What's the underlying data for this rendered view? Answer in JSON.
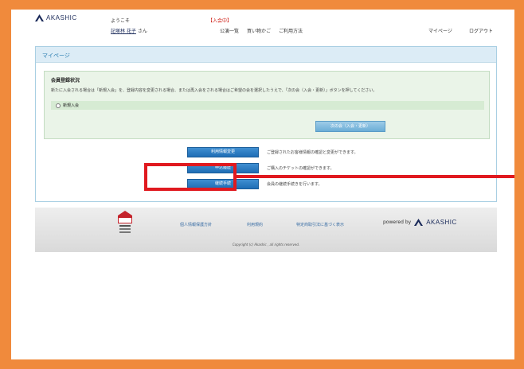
{
  "header": {
    "logo_text": "AKASHIC",
    "welcome": "ようこそ",
    "user_name": "記塚林 花子",
    "user_suffix": " さん",
    "status": "【入会中】",
    "nav": [
      "公演一覧",
      "買い物かご",
      "ご利用方法",
      "マイページ",
      "ログアウト"
    ]
  },
  "mypage": {
    "title": "マイページ",
    "member_status_heading": "会員登録状況",
    "member_description": "新たに入会される場合は「新規入会」を、登録内容を変更される場合、または再入会をされる場合はご希望の会を選択したうえで、「次の会（入会・更新）」ボタンを押してください。",
    "radio_label": "新規入会",
    "next_button": "次の会（入会・更新）",
    "actions": [
      {
        "label": "利用情報変更",
        "desc": "ご登録されたお客様情報の確認と変更ができます。"
      },
      {
        "label": "申込履歴",
        "desc": "ご購入のチケットの確認ができます。"
      },
      {
        "label": "継続手続",
        "desc": "会員の継続手続きを行います。"
      }
    ]
  },
  "footer": {
    "secom_text": "SECOM",
    "links": [
      "個人情報保護方針",
      "利用規約",
      "特定商取引法に基づく表示"
    ],
    "powered_by": "powered by",
    "powered_logo": "AKASHIC",
    "copyright": "Copyright (c) Akashic , all rights reserved."
  },
  "colors": {
    "frame": "#f08a3c",
    "highlight": "#e0191f",
    "button_blue": "#1f6db5",
    "panel_border": "#a9cfe3",
    "member_box": "#eaf4e8"
  }
}
